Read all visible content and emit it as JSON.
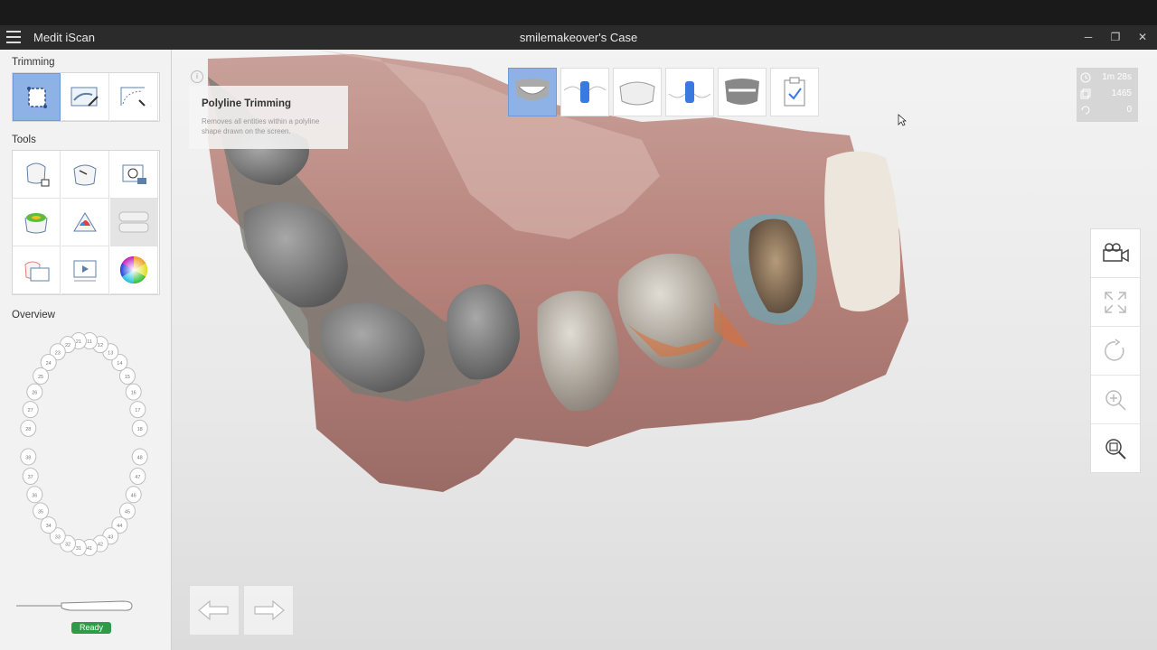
{
  "window": {
    "app_name": "Medit iScan",
    "case_name": "smilemakeover's Case",
    "minimize": "─",
    "restore": "❐",
    "close": "✕"
  },
  "sidebar": {
    "trimming_title": "Trimming",
    "tools_title": "Tools",
    "overview_title": "Overview",
    "trimming_tools": [
      {
        "name": "polyline-trim-icon",
        "active": true
      },
      {
        "name": "brush-trim-icon",
        "active": false
      },
      {
        "name": "plane-trim-icon",
        "active": false
      }
    ],
    "tools": [
      {
        "name": "lock-tooth-icon"
      },
      {
        "name": "fill-holes-icon"
      },
      {
        "name": "capture-3d-icon"
      },
      {
        "name": "color-map-icon"
      },
      {
        "name": "occlusion-icon"
      },
      {
        "name": "bite-alignment-icon",
        "disabled": true
      },
      {
        "name": "snapshot-icon"
      },
      {
        "name": "video-icon"
      },
      {
        "name": "color-wheel-icon"
      }
    ],
    "tooth_numbers_upper": [
      "18",
      "17",
      "16",
      "15",
      "14",
      "13",
      "12",
      "11",
      "21",
      "22",
      "23",
      "24",
      "25",
      "26",
      "27",
      "28"
    ],
    "tooth_numbers_lower": [
      "48",
      "47",
      "46",
      "45",
      "44",
      "43",
      "42",
      "41",
      "31",
      "32",
      "33",
      "34",
      "35",
      "36",
      "37",
      "38"
    ],
    "scanner_status": "Ready"
  },
  "tooltip": {
    "title": "Polyline Trimming",
    "description": "Removes all entities within a polyline shape drawn on the screen."
  },
  "stages": [
    {
      "name": "maxilla-stage-icon",
      "active": true
    },
    {
      "name": "maxilla-scanbody-stage-icon",
      "active": false
    },
    {
      "name": "mandible-stage-icon",
      "active": false
    },
    {
      "name": "mandible-scanbody-stage-icon",
      "active": false
    },
    {
      "name": "occlusion-stage-icon",
      "active": false
    },
    {
      "name": "complete-stage-icon",
      "active": false
    }
  ],
  "stats": {
    "time": "1m 28s",
    "frames": "1465",
    "rotations": "0"
  },
  "right_tools": [
    "camera-view-icon",
    "fit-screen-icon",
    "rotate-icon",
    "zoom-in-icon",
    "zoom-fit-icon"
  ],
  "colors": {
    "accent": "#8fb2e6",
    "ready": "#2e9a4a",
    "gum": "#b07a74",
    "tooth": "#7e7e7e"
  }
}
